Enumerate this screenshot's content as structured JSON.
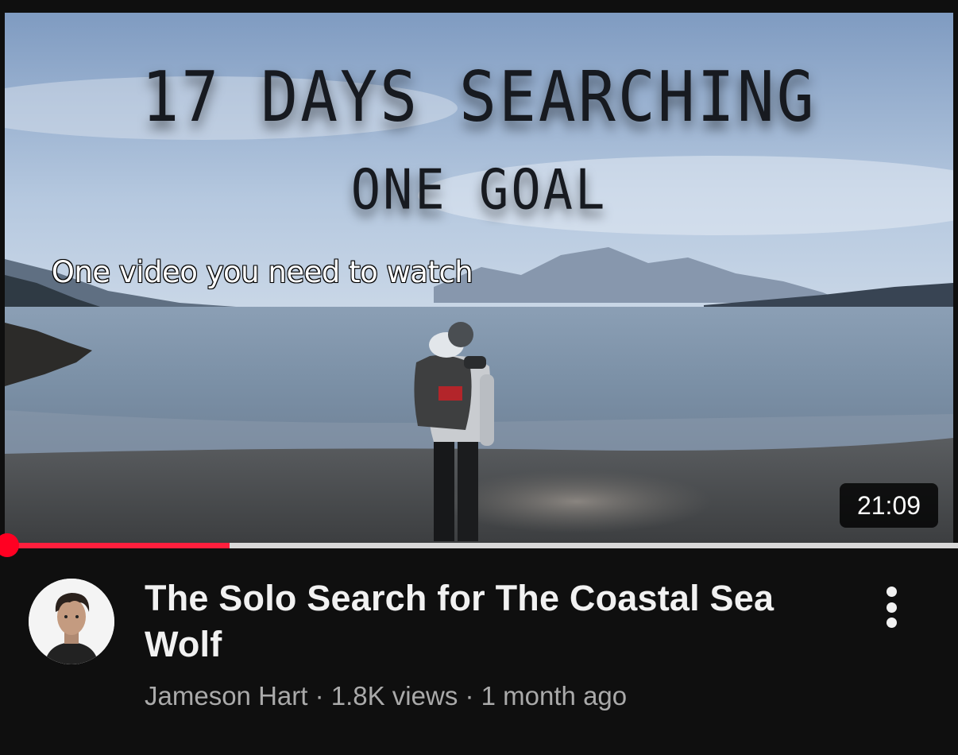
{
  "video": {
    "thumbnail": {
      "headline_line1": "17 DAYS SEARCHING",
      "headline_line2": "ONE GOAL",
      "caption": "One video you need to watch",
      "duration": "21:09",
      "watched_fraction": 0.24
    },
    "title": "The Solo Search for The Coastal Sea Wolf",
    "channel": "Jameson Hart",
    "views": "1.8K views",
    "age": "1 month ago",
    "meta_separator": " · "
  },
  "colors": {
    "background": "#0f0f0f",
    "progress_played": "#ff1f3d",
    "progress_unplayed": "#d9d9d9",
    "meta_text": "#aaaaaa"
  },
  "icons": {
    "menu": "more-vertical-icon"
  }
}
